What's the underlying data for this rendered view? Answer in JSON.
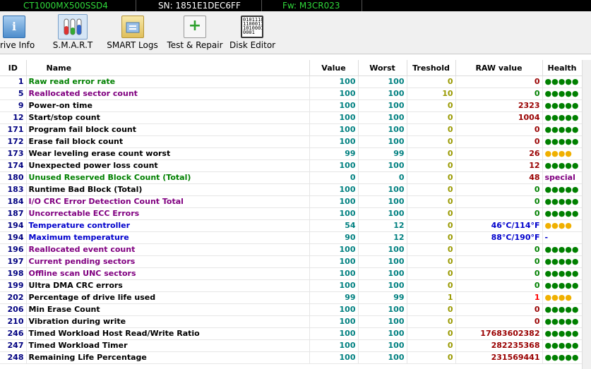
{
  "header": {
    "model": "CT1000MX500SSD4",
    "serial": "SN: 1851E1DEC6FF",
    "firmware": "Fw: M3CR023"
  },
  "toolbar": {
    "info_label": "Drive Info",
    "smart_label": "S.M.A.R.T",
    "smartlogs_label": "SMART Logs",
    "test_label": "Test & Repair",
    "disk_label": "Disk Editor",
    "disk_icon_text": "0101110 1100011 1010001 0001"
  },
  "colors": {
    "green": "#008000",
    "purple": "#800080",
    "black": "#000000",
    "blue": "#0000cc",
    "raw_red": "#990000",
    "bright_red": "#ff0000",
    "health_green": "#008000",
    "health_yellow": "#f0b000"
  },
  "columns": [
    "ID",
    "Name",
    "Value",
    "Worst",
    "Treshold",
    "RAW value",
    "Health"
  ],
  "rows": [
    {
      "id": "1",
      "name": "Raw read error rate",
      "value": "100",
      "worst": "100",
      "threshold": "0",
      "raw": "0",
      "health": "●●●●●",
      "name_color": "green",
      "raw_color": "raw_red",
      "health_color": "health_green"
    },
    {
      "id": "5",
      "name": "Reallocated sector count",
      "value": "100",
      "worst": "100",
      "threshold": "10",
      "raw": "0",
      "health": "●●●●●",
      "name_color": "purple",
      "raw_color": "health_green",
      "health_color": "health_green"
    },
    {
      "id": "9",
      "name": "Power-on time",
      "value": "100",
      "worst": "100",
      "threshold": "0",
      "raw": "2323",
      "health": "●●●●●",
      "name_color": "black",
      "raw_color": "raw_red",
      "health_color": "health_green"
    },
    {
      "id": "12",
      "name": "Start/stop count",
      "value": "100",
      "worst": "100",
      "threshold": "0",
      "raw": "1004",
      "health": "●●●●●",
      "name_color": "black",
      "raw_color": "raw_red",
      "health_color": "health_green"
    },
    {
      "id": "171",
      "name": "Program fail block count",
      "value": "100",
      "worst": "100",
      "threshold": "0",
      "raw": "0",
      "health": "●●●●●",
      "name_color": "black",
      "raw_color": "raw_red",
      "health_color": "health_green"
    },
    {
      "id": "172",
      "name": "Erase fail block count",
      "value": "100",
      "worst": "100",
      "threshold": "0",
      "raw": "0",
      "health": "●●●●●",
      "name_color": "black",
      "raw_color": "raw_red",
      "health_color": "health_green"
    },
    {
      "id": "173",
      "name": "Wear leveling erase count worst",
      "value": "99",
      "worst": "99",
      "threshold": "0",
      "raw": "26",
      "health": "●●●●",
      "name_color": "black",
      "raw_color": "raw_red",
      "health_color": "health_yellow"
    },
    {
      "id": "174",
      "name": "Unexpected power loss count",
      "value": "100",
      "worst": "100",
      "threshold": "0",
      "raw": "12",
      "health": "●●●●●",
      "name_color": "black",
      "raw_color": "raw_red",
      "health_color": "health_green"
    },
    {
      "id": "180",
      "name": "Unused Reserved Block Count (Total)",
      "value": "0",
      "worst": "0",
      "threshold": "0",
      "raw": "48",
      "health": "special",
      "name_color": "green",
      "raw_color": "raw_red",
      "health_color": "purple"
    },
    {
      "id": "183",
      "name": "Runtime Bad Block (Total)",
      "value": "100",
      "worst": "100",
      "threshold": "0",
      "raw": "0",
      "health": "●●●●●",
      "name_color": "black",
      "raw_color": "health_green",
      "health_color": "health_green"
    },
    {
      "id": "184",
      "name": "I/O CRC Error Detection Count Total",
      "value": "100",
      "worst": "100",
      "threshold": "0",
      "raw": "0",
      "health": "●●●●●",
      "name_color": "purple",
      "raw_color": "health_green",
      "health_color": "health_green"
    },
    {
      "id": "187",
      "name": "Uncorrectable ECC Errors",
      "value": "100",
      "worst": "100",
      "threshold": "0",
      "raw": "0",
      "health": "●●●●●",
      "name_color": "purple",
      "raw_color": "health_green",
      "health_color": "health_green"
    },
    {
      "id": "194",
      "name": "Temperature controller",
      "value": "54",
      "worst": "12",
      "threshold": "0",
      "raw": "46°C/114°F",
      "health": "●●●●",
      "name_color": "blue",
      "raw_color": "blue",
      "health_color": "health_yellow"
    },
    {
      "id": "194",
      "name": "Maximum temperature",
      "value": "90",
      "worst": "12",
      "threshold": "0",
      "raw": "88°C/190°F",
      "health": "-",
      "name_color": "blue",
      "raw_color": "blue",
      "health_color": "blue"
    },
    {
      "id": "196",
      "name": "Reallocated event count",
      "value": "100",
      "worst": "100",
      "threshold": "0",
      "raw": "0",
      "health": "●●●●●",
      "name_color": "purple",
      "raw_color": "health_green",
      "health_color": "health_green"
    },
    {
      "id": "197",
      "name": "Current pending sectors",
      "value": "100",
      "worst": "100",
      "threshold": "0",
      "raw": "0",
      "health": "●●●●●",
      "name_color": "purple",
      "raw_color": "health_green",
      "health_color": "health_green"
    },
    {
      "id": "198",
      "name": "Offline scan UNC sectors",
      "value": "100",
      "worst": "100",
      "threshold": "0",
      "raw": "0",
      "health": "●●●●●",
      "name_color": "purple",
      "raw_color": "health_green",
      "health_color": "health_green"
    },
    {
      "id": "199",
      "name": "Ultra DMA CRC errors",
      "value": "100",
      "worst": "100",
      "threshold": "0",
      "raw": "0",
      "health": "●●●●●",
      "name_color": "black",
      "raw_color": "health_green",
      "health_color": "health_green"
    },
    {
      "id": "202",
      "name": "Percentage of drive life used",
      "value": "99",
      "worst": "99",
      "threshold": "1",
      "raw": "1",
      "health": "●●●●",
      "name_color": "black",
      "raw_color": "bright_red",
      "health_color": "health_yellow"
    },
    {
      "id": "206",
      "name": "Min Erase Count",
      "value": "100",
      "worst": "100",
      "threshold": "0",
      "raw": "0",
      "health": "●●●●●",
      "name_color": "black",
      "raw_color": "raw_red",
      "health_color": "health_green"
    },
    {
      "id": "210",
      "name": "Vibration during write",
      "value": "100",
      "worst": "100",
      "threshold": "0",
      "raw": "0",
      "health": "●●●●●",
      "name_color": "black",
      "raw_color": "raw_red",
      "health_color": "health_green"
    },
    {
      "id": "246",
      "name": "Timed Workload Host Read/Write Ratio",
      "value": "100",
      "worst": "100",
      "threshold": "0",
      "raw": "17683602382",
      "health": "●●●●●",
      "name_color": "black",
      "raw_color": "raw_red",
      "health_color": "health_green"
    },
    {
      "id": "247",
      "name": "Timed Workload Timer",
      "value": "100",
      "worst": "100",
      "threshold": "0",
      "raw": "282235368",
      "health": "●●●●●",
      "name_color": "black",
      "raw_color": "raw_red",
      "health_color": "health_green"
    },
    {
      "id": "248",
      "name": "Remaining Life Percentage",
      "value": "100",
      "worst": "100",
      "threshold": "0",
      "raw": "231569441",
      "health": "●●●●●",
      "name_color": "black",
      "raw_color": "raw_red",
      "health_color": "health_green"
    }
  ]
}
